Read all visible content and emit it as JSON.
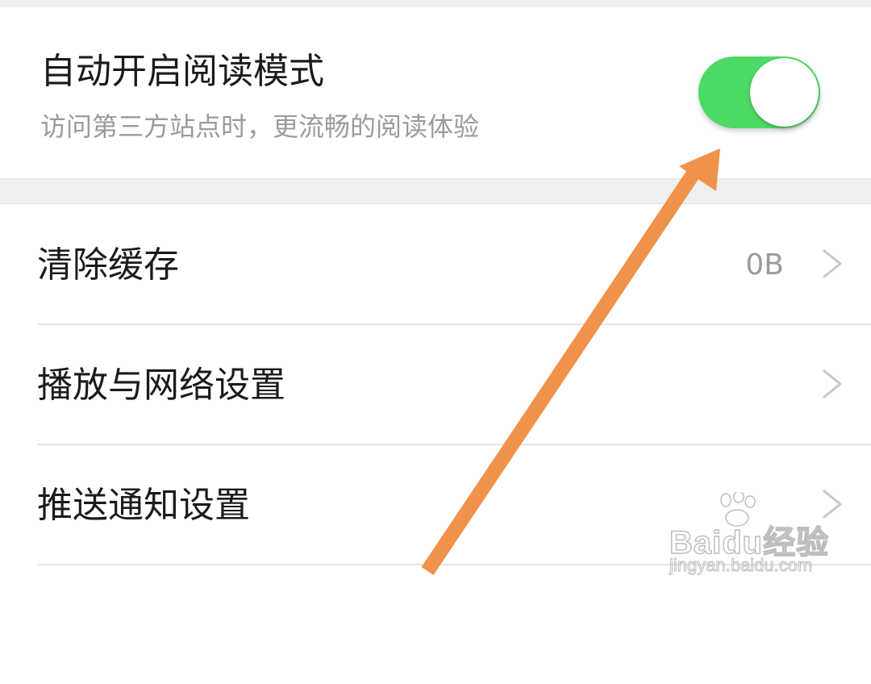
{
  "reading_mode": {
    "title": "自动开启阅读模式",
    "description": "访问第三方站点时，更流畅的阅读体验",
    "enabled": true,
    "toggle_on_color": "#4cd964"
  },
  "settings_list": {
    "items": [
      {
        "label": "清除缓存",
        "value": "0B",
        "icon": "chevron-right-icon"
      },
      {
        "label": "播放与网络设置",
        "value": "",
        "icon": "chevron-right-icon"
      },
      {
        "label": "推送通知设置",
        "value": "",
        "icon": "chevron-right-icon"
      }
    ]
  },
  "annotation": {
    "icon": "arrow-annotation",
    "color": "#f0924a"
  },
  "watermark": {
    "brand": "Baidu经验",
    "url": "jingyan.baidu.com",
    "icon": "baidu-paw-logo"
  }
}
